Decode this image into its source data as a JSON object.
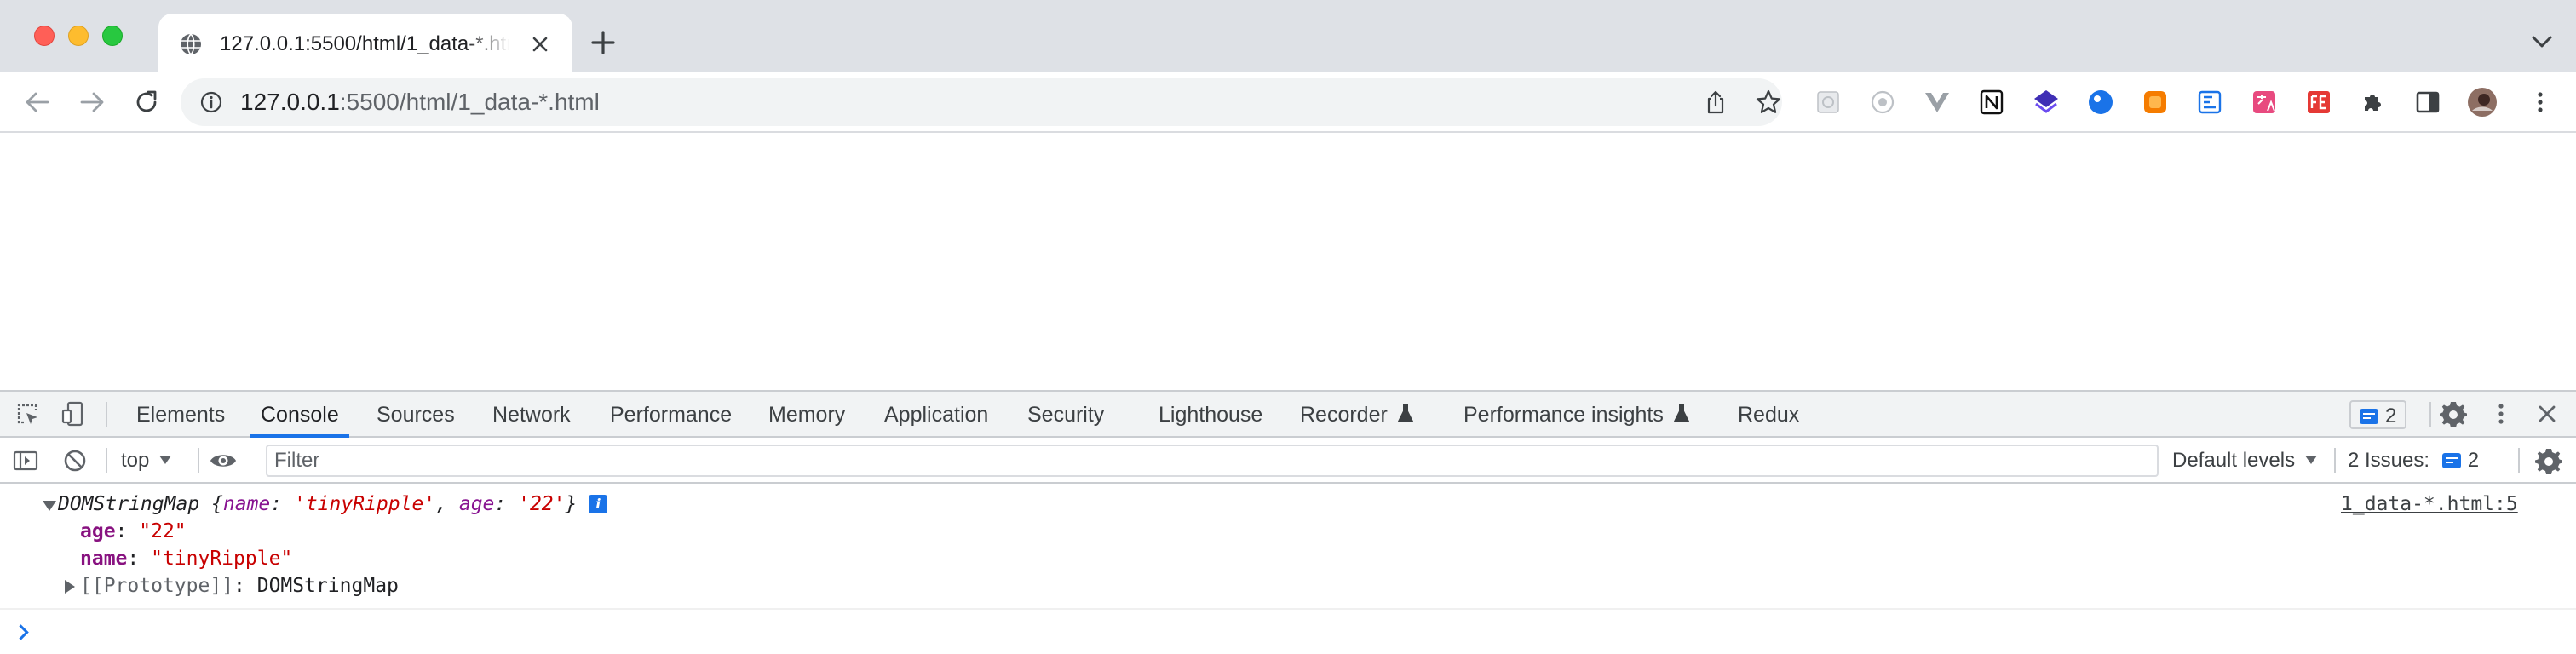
{
  "browser": {
    "tab": {
      "title": "127.0.0.1:5500/html/1_data-*.html"
    },
    "address": {
      "host": "127.0.0.1",
      "path": ":5500/html/1_data-*.html"
    }
  },
  "devtools": {
    "tabs": [
      {
        "label": "Elements"
      },
      {
        "label": "Console",
        "active": true
      },
      {
        "label": "Sources"
      },
      {
        "label": "Network"
      },
      {
        "label": "Performance"
      },
      {
        "label": "Memory"
      },
      {
        "label": "Application"
      },
      {
        "label": "Security"
      },
      {
        "label": "Lighthouse"
      },
      {
        "label": "Recorder",
        "experimental": true
      },
      {
        "label": "Performance insights",
        "experimental": true
      },
      {
        "label": "Redux"
      }
    ],
    "issues_count": "2",
    "console_toolbar": {
      "context": "top",
      "filter_placeholder": "Filter",
      "levels": "Default levels",
      "issues_label": "2 Issues:",
      "issues_count": "2"
    },
    "log": {
      "summary_type": "DOMStringMap",
      "summary_open": "{",
      "summary_close": "}",
      "props_preview": [
        {
          "key": "name",
          "value": "'tinyRipple'"
        },
        {
          "key": "age",
          "value": "'22'"
        }
      ],
      "info_badge": "i",
      "source": "1_data-*.html:5",
      "entries": [
        {
          "key": "age",
          "value": "\"22\""
        },
        {
          "key": "name",
          "value": "\"tinyRipple\""
        }
      ],
      "prototype_label": "[[Prototype]]",
      "prototype_value": "DOMStringMap"
    }
  },
  "colors": {
    "accent": "#1a73e8",
    "tabstrip": "#dee1e6",
    "string": "#c80000",
    "property": "#881391"
  }
}
